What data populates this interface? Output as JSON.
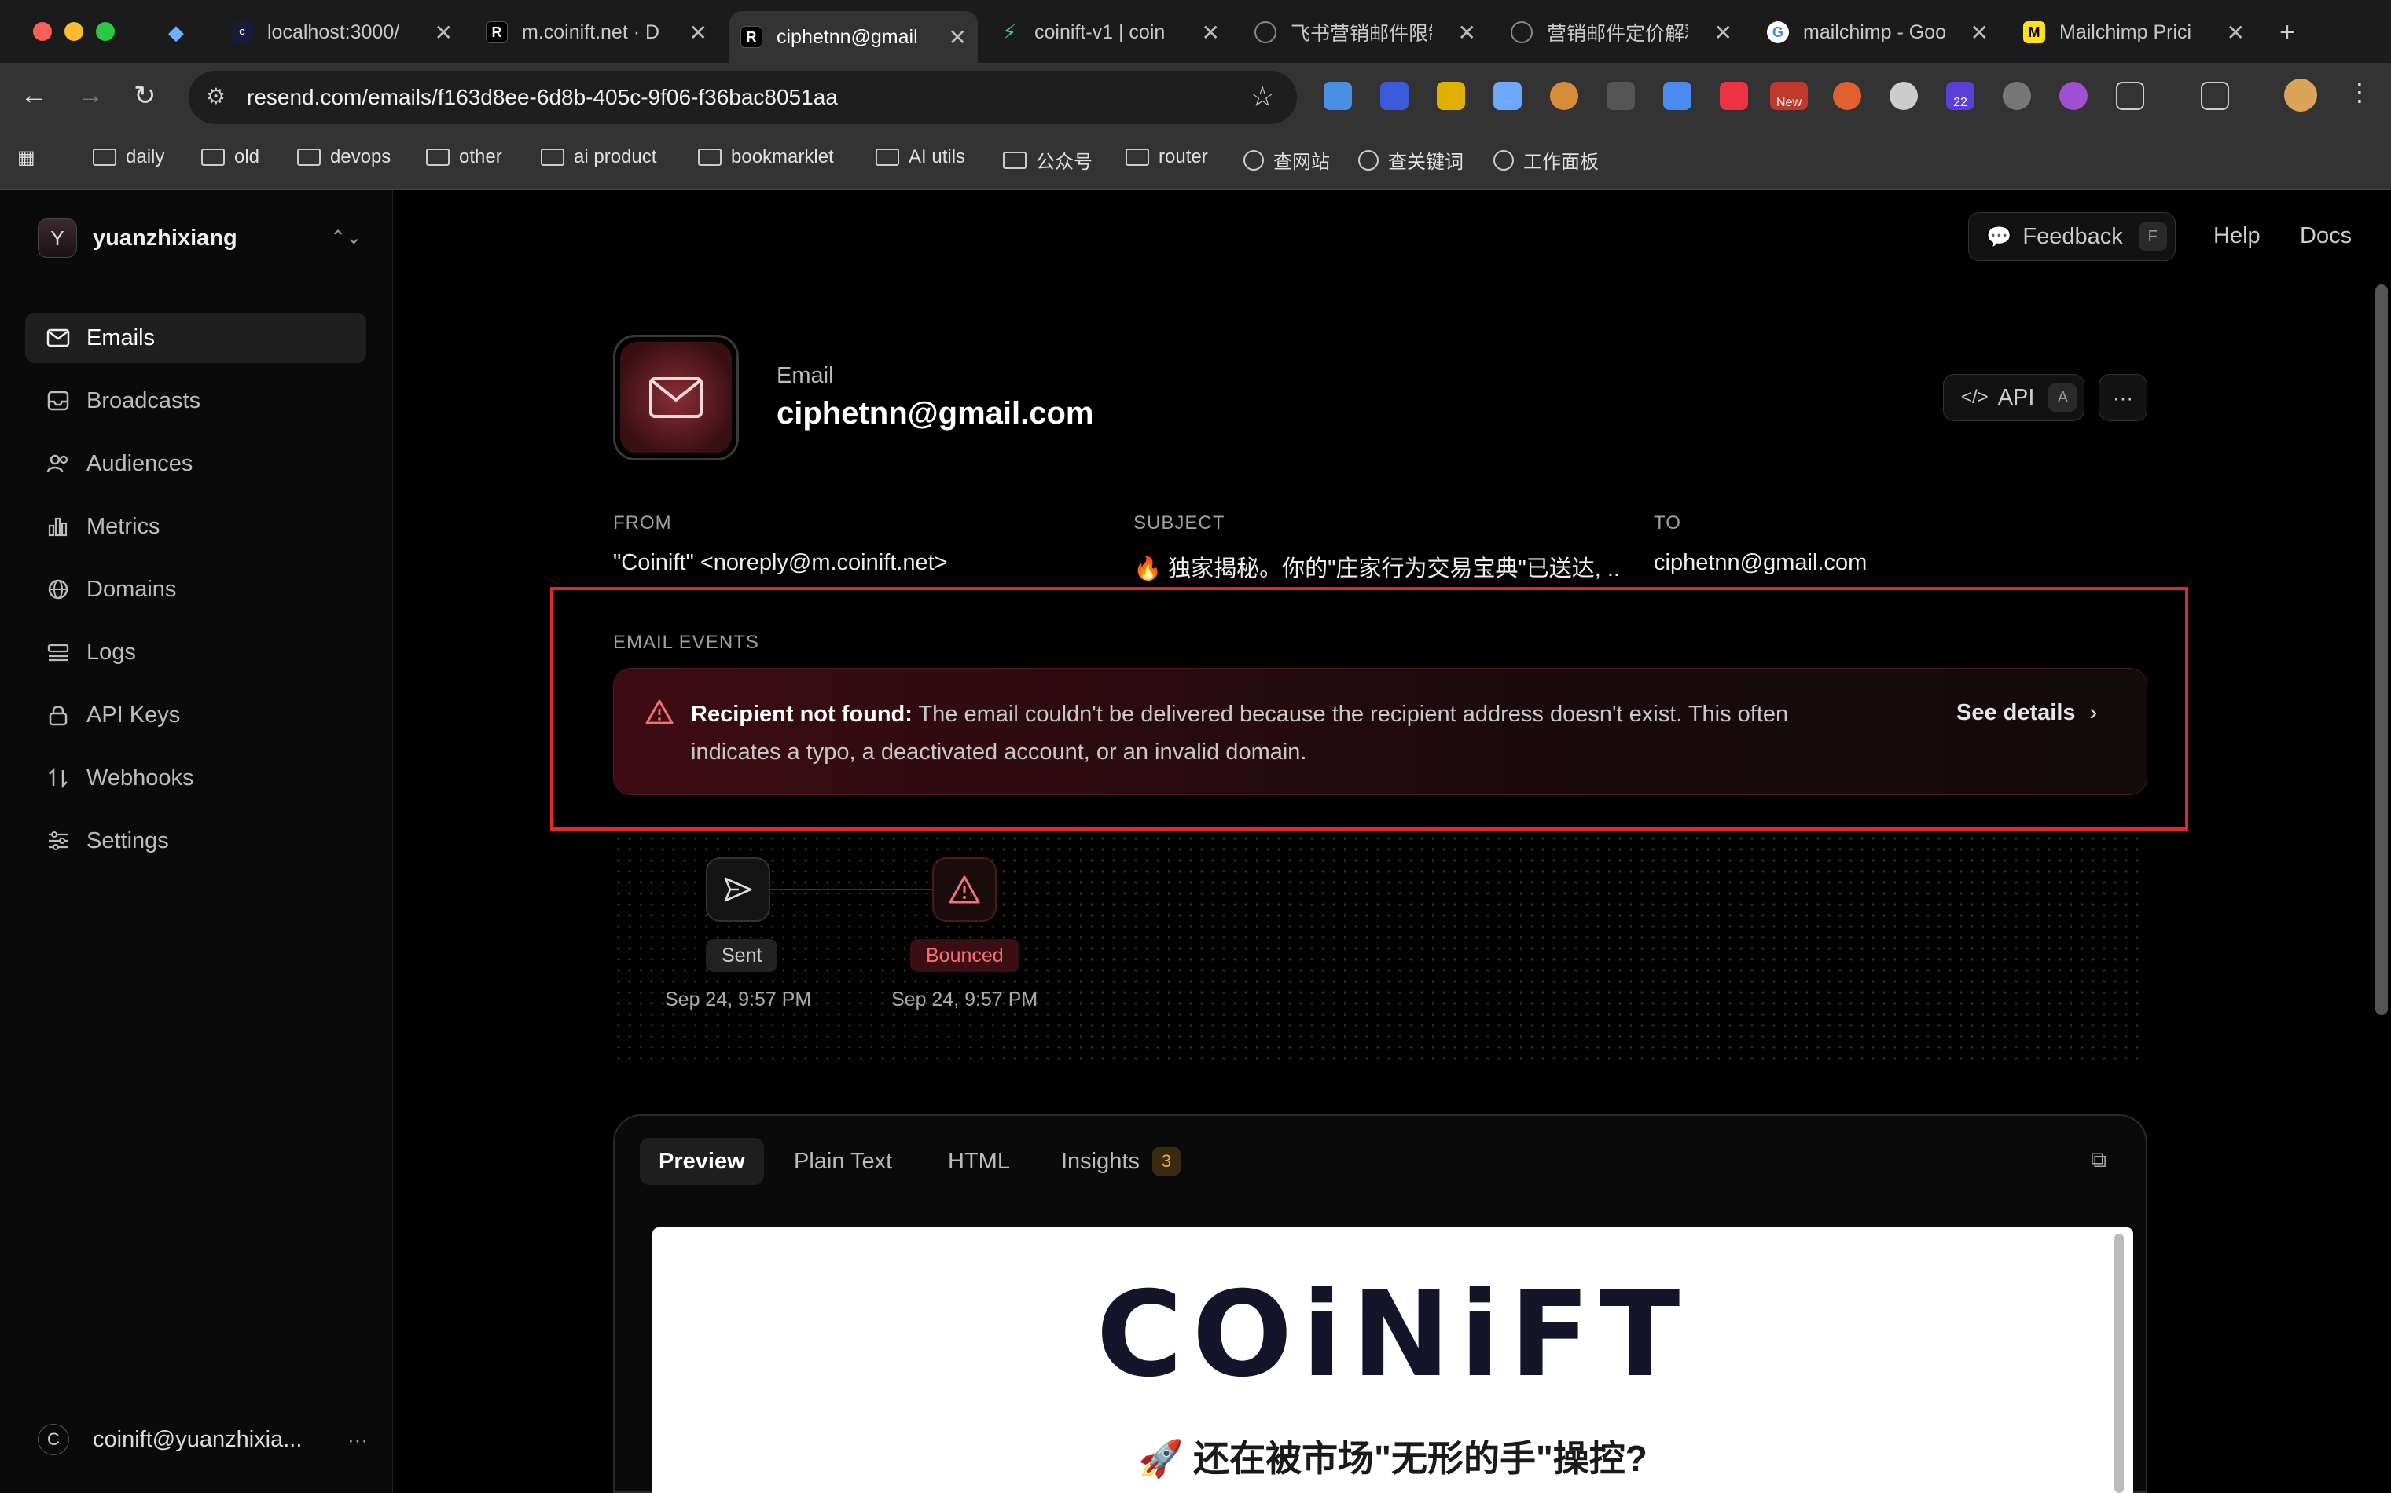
{
  "browser": {
    "tabs": [
      {
        "title": "",
        "favicon": "gem-icon"
      },
      {
        "title": "localhost:3000/",
        "favicon": "coinift-icon"
      },
      {
        "title": "m.coinift.net · D",
        "favicon": "resend-icon"
      },
      {
        "title": "ciphetnn@gmail",
        "favicon": "resend-icon"
      },
      {
        "title": "coinift-v1 | coin",
        "favicon": "bolt-icon"
      },
      {
        "title": "飞书营销邮件限制",
        "favicon": "openai-icon"
      },
      {
        "title": "营销邮件定价解释",
        "favicon": "openai-icon"
      },
      {
        "title": "mailchimp - Goo",
        "favicon": "google-icon"
      },
      {
        "title": "Mailchimp Prici",
        "favicon": "mailchimp-icon"
      }
    ],
    "url": "resend.com/emails/f163d8ee-6d8b-405c-9f06-f36bac8051aa",
    "extension_badges": {
      "new": "New",
      "count": "22"
    },
    "bookmarks": [
      "daily",
      "old",
      "devops",
      "other",
      "ai product",
      "bookmarklet",
      "AI utils",
      "公众号",
      "router",
      "查网站",
      "查关键词",
      "工作面板"
    ]
  },
  "sidebar": {
    "workspace_initial": "Y",
    "workspace_name": "yuanzhixiang",
    "items": [
      "Emails",
      "Broadcasts",
      "Audiences",
      "Metrics",
      "Domains",
      "Logs",
      "API Keys",
      "Webhooks",
      "Settings"
    ],
    "footer_initial": "C",
    "footer_email": "coinift@yuanzhixia...",
    "footer_more": "···"
  },
  "topbar": {
    "feedback_label": "Feedback",
    "feedback_key": "F",
    "help": "Help",
    "docs": "Docs"
  },
  "email": {
    "kind": "Email",
    "address": "ciphetnn@gmail.com",
    "api_label": "API",
    "api_key": "A",
    "more": "···",
    "from_label": "FROM",
    "from_value": "\"Coinift\" <noreply@m.coinift.net>",
    "subject_label": "SUBJECT",
    "subject_value": "🔥 独家揭秘。你的\"庄家行为交易宝典\"已送达, ...",
    "to_label": "TO",
    "to_value": "ciphetnn@gmail.com"
  },
  "events": {
    "section_label": "EMAIL EVENTS",
    "alert_title": "Recipient not found:",
    "alert_text": " The email couldn't be delivered because the recipient address doesn't exist. This often indicates a typo, a deactivated account, or an invalid domain.",
    "see_details": "See details",
    "timeline": [
      {
        "status": "Sent",
        "time": "Sep 24, 9:57 PM"
      },
      {
        "status": "Bounced",
        "time": "Sep 24, 9:57 PM"
      }
    ],
    "colors": {
      "bounced": "#f87171",
      "alert_bg": "#3e0b14"
    }
  },
  "preview": {
    "tabs": [
      "Preview",
      "Plain Text",
      "HTML",
      "Insights"
    ],
    "insights_count": "3",
    "logo_text": "COiNiFT",
    "headline": "🚀 还在被市场\"无形的手\"操控?"
  }
}
